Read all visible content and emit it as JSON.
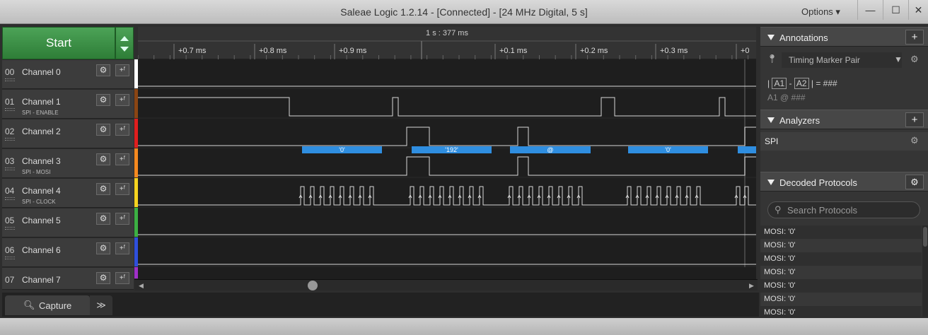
{
  "window": {
    "title": "Saleae Logic 1.2.14 - [Connected] - [24 MHz Digital, 5 s]",
    "options_label": "Options ▾",
    "min_glyph": "—",
    "max_glyph": "☐",
    "close_glyph": "✕"
  },
  "start": {
    "label": "Start"
  },
  "channels": [
    {
      "num": "00",
      "name": "Channel 0",
      "sub": "",
      "color": "#ffffff"
    },
    {
      "num": "01",
      "name": "Channel 1",
      "sub": "SPI - ENABLE",
      "color": "#8b4513"
    },
    {
      "num": "02",
      "name": "Channel 2",
      "sub": "",
      "color": "#e01e1e"
    },
    {
      "num": "03",
      "name": "Channel 3",
      "sub": "SPI - MOSI",
      "color": "#f5891f"
    },
    {
      "num": "04",
      "name": "Channel 4",
      "sub": "SPI - CLOCK",
      "color": "#f5d31f"
    },
    {
      "num": "05",
      "name": "Channel 5",
      "sub": "",
      "color": "#3cb043"
    },
    {
      "num": "06",
      "name": "Channel 6",
      "sub": "",
      "color": "#2f4fdc"
    },
    {
      "num": "07",
      "name": "Channel 7",
      "sub": "",
      "color": "#a030c8"
    }
  ],
  "timeline": {
    "header": "1 s : 377 ms",
    "ticks": [
      "+0.7 ms",
      "+0.8 ms",
      "+0.9 ms",
      "+0.1 ms",
      "+0.2 ms",
      "+0.3 ms",
      "+0"
    ]
  },
  "decoded_bubbles": [
    "'0'",
    "'192'",
    "@",
    "'0'"
  ],
  "bottom": {
    "capture_tab": "Capture",
    "more_glyph": "≫"
  },
  "annotations": {
    "title": "Annotations",
    "add_glyph": "+",
    "marker_pair": "Timing Marker Pair",
    "line1": {
      "pre": "|",
      "a1": "A1",
      "dash": "-",
      "a2": "A2",
      "post": "| = ###"
    },
    "line2": "A1  @  ###"
  },
  "analyzers": {
    "title": "Analyzers",
    "add_glyph": "+",
    "items": [
      "SPI"
    ]
  },
  "decoded_protocols": {
    "title": "Decoded Protocols",
    "search_placeholder": "Search Protocols",
    "results": [
      "MOSI: '0'",
      "MOSI: '0'",
      "MOSI: '0'",
      "MOSI: '0'",
      "MOSI: '0'",
      "MOSI: '0'",
      "MOSI: '0'"
    ]
  }
}
